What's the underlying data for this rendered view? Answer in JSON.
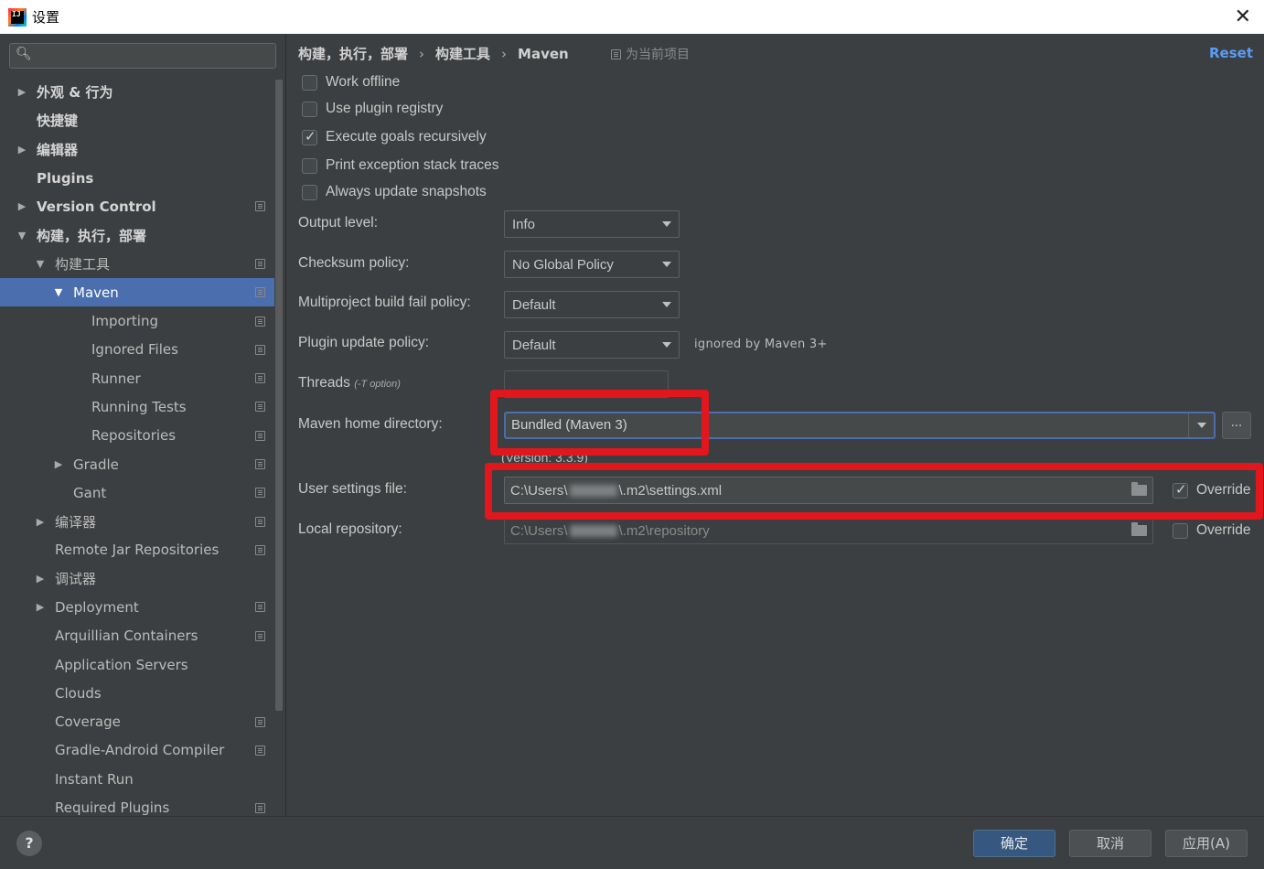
{
  "window": {
    "title": "设置",
    "logo_text": "IJ",
    "close_glyph": "✕"
  },
  "sidebar": {
    "search": {
      "value": "",
      "placeholder": ""
    },
    "items": [
      {
        "label": "外观 & 行为",
        "arrow": "▶",
        "indent": 0,
        "bold": true,
        "project_icon": false,
        "selected": false
      },
      {
        "label": "快捷键",
        "arrow": "",
        "indent": 0,
        "bold": true,
        "project_icon": false,
        "selected": false
      },
      {
        "label": "编辑器",
        "arrow": "▶",
        "indent": 0,
        "bold": true,
        "project_icon": false,
        "selected": false
      },
      {
        "label": "Plugins",
        "arrow": "",
        "indent": 0,
        "bold": true,
        "project_icon": false,
        "selected": false
      },
      {
        "label": "Version Control",
        "arrow": "▶",
        "indent": 0,
        "bold": true,
        "project_icon": true,
        "selected": false
      },
      {
        "label": "构建，执行，部署",
        "arrow": "▼",
        "indent": 0,
        "bold": true,
        "project_icon": false,
        "selected": false
      },
      {
        "label": "构建工具",
        "arrow": "▼",
        "indent": 1,
        "bold": false,
        "project_icon": true,
        "selected": false
      },
      {
        "label": "Maven",
        "arrow": "▼",
        "indent": 2,
        "bold": false,
        "project_icon": true,
        "selected": true
      },
      {
        "label": "Importing",
        "arrow": "",
        "indent": 3,
        "bold": false,
        "project_icon": true,
        "selected": false
      },
      {
        "label": "Ignored Files",
        "arrow": "",
        "indent": 3,
        "bold": false,
        "project_icon": true,
        "selected": false
      },
      {
        "label": "Runner",
        "arrow": "",
        "indent": 3,
        "bold": false,
        "project_icon": true,
        "selected": false
      },
      {
        "label": "Running Tests",
        "arrow": "",
        "indent": 3,
        "bold": false,
        "project_icon": true,
        "selected": false
      },
      {
        "label": "Repositories",
        "arrow": "",
        "indent": 3,
        "bold": false,
        "project_icon": true,
        "selected": false
      },
      {
        "label": "Gradle",
        "arrow": "▶",
        "indent": 2,
        "bold": false,
        "project_icon": true,
        "selected": false
      },
      {
        "label": "Gant",
        "arrow": "",
        "indent": 2,
        "bold": false,
        "project_icon": true,
        "selected": false
      },
      {
        "label": "编译器",
        "arrow": "▶",
        "indent": 1,
        "bold": false,
        "project_icon": true,
        "selected": false
      },
      {
        "label": "Remote Jar Repositories",
        "arrow": "",
        "indent": 1,
        "bold": false,
        "project_icon": true,
        "selected": false
      },
      {
        "label": "调试器",
        "arrow": "▶",
        "indent": 1,
        "bold": false,
        "project_icon": false,
        "selected": false
      },
      {
        "label": "Deployment",
        "arrow": "▶",
        "indent": 1,
        "bold": false,
        "project_icon": true,
        "selected": false
      },
      {
        "label": "Arquillian Containers",
        "arrow": "",
        "indent": 1,
        "bold": false,
        "project_icon": true,
        "selected": false
      },
      {
        "label": "Application Servers",
        "arrow": "",
        "indent": 1,
        "bold": false,
        "project_icon": false,
        "selected": false
      },
      {
        "label": "Clouds",
        "arrow": "",
        "indent": 1,
        "bold": false,
        "project_icon": false,
        "selected": false
      },
      {
        "label": "Coverage",
        "arrow": "",
        "indent": 1,
        "bold": false,
        "project_icon": true,
        "selected": false
      },
      {
        "label": "Gradle-Android Compiler",
        "arrow": "",
        "indent": 1,
        "bold": false,
        "project_icon": true,
        "selected": false
      },
      {
        "label": "Instant Run",
        "arrow": "",
        "indent": 1,
        "bold": false,
        "project_icon": false,
        "selected": false
      },
      {
        "label": "Required Plugins",
        "arrow": "",
        "indent": 1,
        "bold": false,
        "project_icon": true,
        "selected": false
      }
    ]
  },
  "main": {
    "breadcrumb": [
      "构建，执行，部署",
      "构建工具",
      "Maven"
    ],
    "breadcrumb_sep": "›",
    "for_project": "为当前项目",
    "reset": "Reset",
    "checkboxes": [
      {
        "label": "Work offline",
        "checked": false
      },
      {
        "label": "Use plugin registry",
        "checked": false
      },
      {
        "label": "Execute goals recursively",
        "checked": true
      },
      {
        "label": "Print exception stack traces",
        "checked": false
      },
      {
        "label": "Always update snapshots",
        "checked": false
      }
    ],
    "output_level": {
      "label": "Output level:",
      "value": "Info"
    },
    "checksum_policy": {
      "label": "Checksum policy:",
      "value": "No Global Policy"
    },
    "multiproject_policy": {
      "label": "Multiproject build fail policy:",
      "value": "Default"
    },
    "plugin_update_policy": {
      "label": "Plugin update policy:",
      "value": "Default",
      "hint": "ignored by Maven 3+"
    },
    "threads": {
      "label": "Threads",
      "note": "(-T option)",
      "value": ""
    },
    "maven_home": {
      "label": "Maven home directory:",
      "value": "Bundled (Maven 3)",
      "browse": "...",
      "version": "(Version: 3.3.9)"
    },
    "user_settings": {
      "label": "User settings file:",
      "value_prefix": "C:\\Users\\",
      "value_suffix": "\\.m2\\settings.xml",
      "override_label": "Override",
      "override_checked": true
    },
    "local_repo": {
      "label": "Local repository:",
      "value_prefix": "C:\\Users\\",
      "value_suffix": "\\.m2\\repository",
      "override_label": "Override",
      "override_checked": false
    }
  },
  "footer": {
    "help": "?",
    "ok": "确定",
    "cancel": "取消",
    "apply": "应用(A)"
  },
  "colors": {
    "selection": "#4b6eaf",
    "link": "#589df6",
    "highlight_box": "#e2171e",
    "primary_button": "#365880"
  }
}
